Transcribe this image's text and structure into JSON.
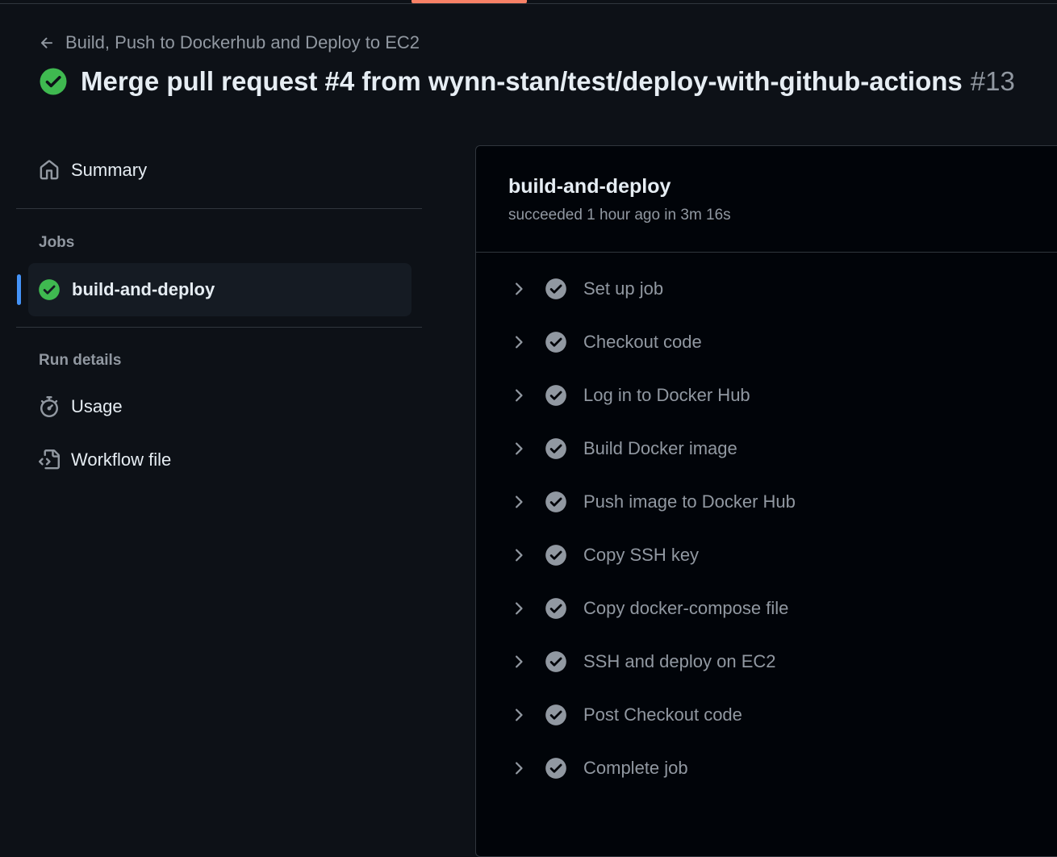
{
  "header": {
    "back_label": "Build, Push to Dockerhub and Deploy to EC2",
    "run_title": "Merge pull request #4 from wynn-stan/test/deploy-with-github-actions",
    "run_number": "#13"
  },
  "sidebar": {
    "summary_label": "Summary",
    "jobs_heading": "Jobs",
    "jobs": [
      {
        "label": "build-and-deploy",
        "status": "success"
      }
    ],
    "run_details_heading": "Run details",
    "usage_label": "Usage",
    "workflow_file_label": "Workflow file"
  },
  "job": {
    "name": "build-and-deploy",
    "meta": "succeeded 1 hour ago in 3m 16s",
    "steps": [
      {
        "label": "Set up job"
      },
      {
        "label": "Checkout code"
      },
      {
        "label": "Log in to Docker Hub"
      },
      {
        "label": "Build Docker image"
      },
      {
        "label": "Push image to Docker Hub"
      },
      {
        "label": "Copy SSH key"
      },
      {
        "label": "Copy docker-compose file"
      },
      {
        "label": "SSH and deploy on EC2"
      },
      {
        "label": "Post Checkout code"
      },
      {
        "label": "Complete job"
      }
    ]
  },
  "colors": {
    "background": "#0d1117",
    "panel": "#010409",
    "success": "#3fb950",
    "step_check": "#9198a1",
    "accent": "#4493f8",
    "tab_underline": "#f78166"
  }
}
